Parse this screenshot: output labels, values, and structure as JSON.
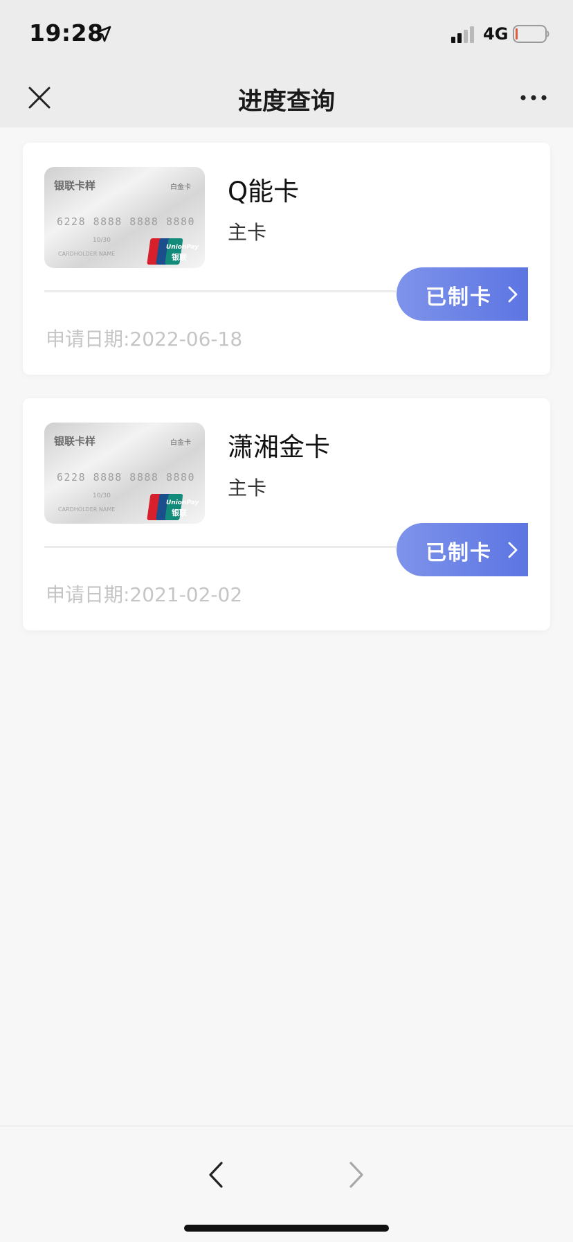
{
  "status_bar": {
    "time": "19:28",
    "network": "4G",
    "icons": [
      "location-arrow-icon",
      "signal-icon",
      "battery-icon"
    ]
  },
  "nav": {
    "title": "进度查询",
    "close_icon": "close-icon",
    "more_icon": "more-icon"
  },
  "card_image": {
    "bank_text": "银联卡样",
    "tier_text": "白金卡",
    "number_text": "6228 8888 8888 8880",
    "expiry_text": "10/30",
    "holder_text": "CARDHOLDER NAME",
    "logo_text_top": "UnionPay",
    "logo_text_bottom": "银联"
  },
  "applications": [
    {
      "card_name": "Q能卡",
      "card_type": "主卡",
      "apply_date": "申请日期:2022-06-18",
      "status": "已制卡"
    },
    {
      "card_name": "潇湘金卡",
      "card_type": "主卡",
      "apply_date": "申请日期:2021-02-02",
      "status": "已制卡"
    }
  ],
  "bottom_bar": {
    "back_icon": "chevron-left-icon",
    "forward_icon": "chevron-right-icon"
  },
  "colors": {
    "accent": "#5c75e2",
    "accent_light": "#7e93ea",
    "background": "#f7f7f7",
    "bar_background": "#ececec"
  }
}
